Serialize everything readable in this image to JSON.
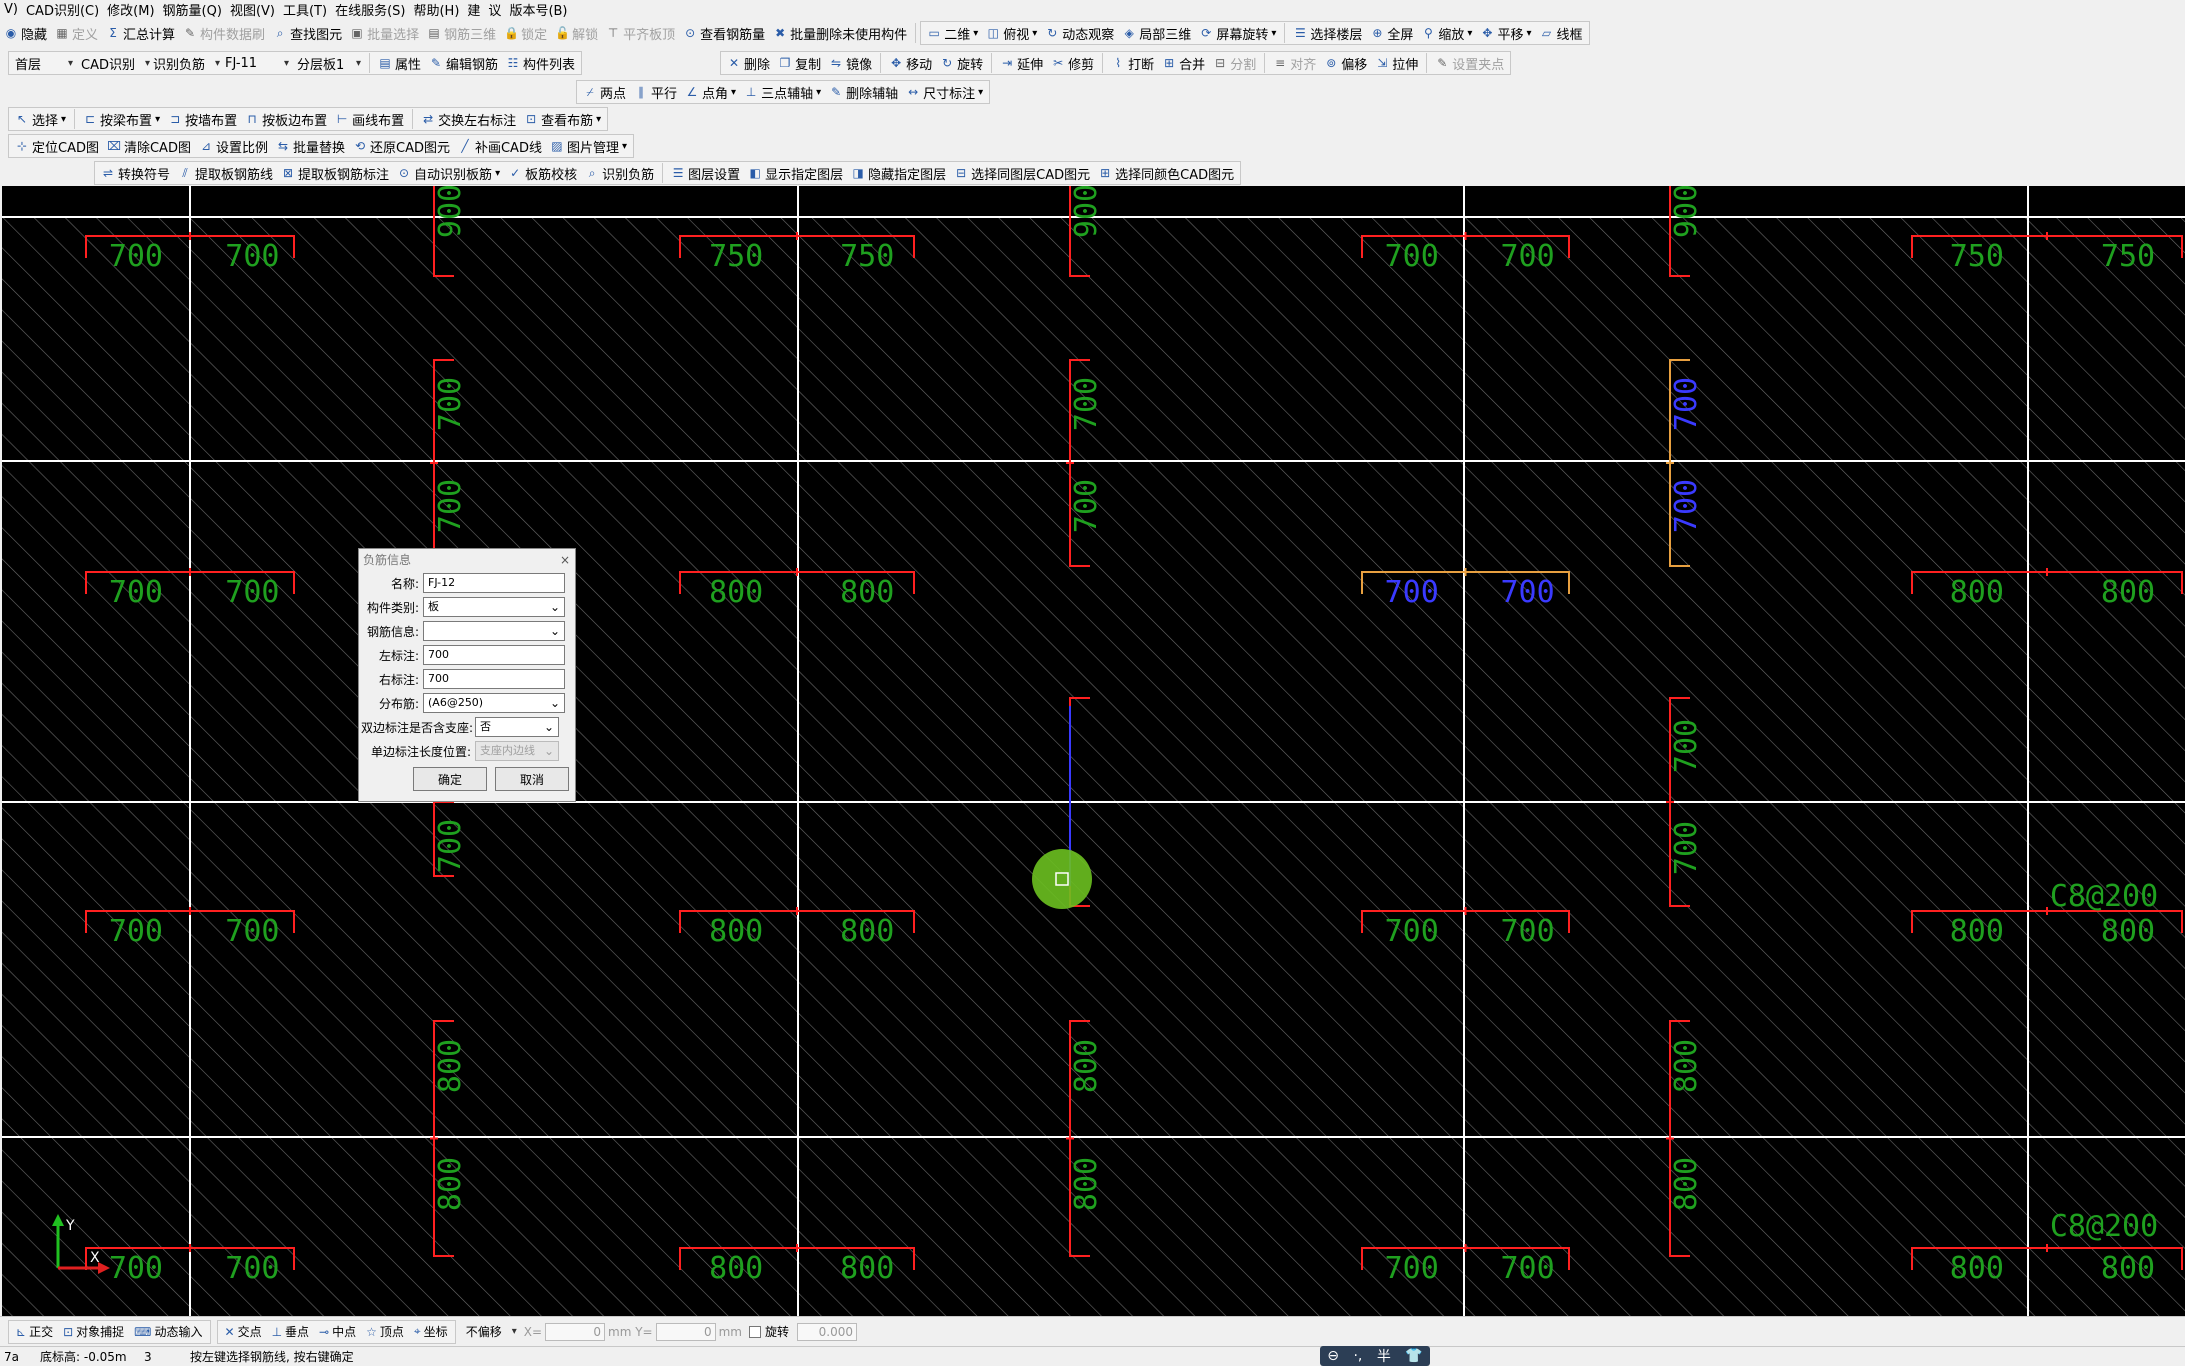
{
  "menu": [
    "V)",
    "CAD识别(C)",
    "修改(M)",
    "钢筋量(Q)",
    "视图(V)",
    "工具(T)",
    "在线服务(S)",
    "帮助(H)",
    "建",
    "议",
    "版本号(B)"
  ],
  "toolbar1": {
    "items": [
      {
        "label": "隐藏",
        "icon": "eye-icon",
        "disabled": false
      },
      {
        "label": "定义",
        "icon": "define-icon",
        "disabled": true
      },
      {
        "label": "汇总计算",
        "icon": "sigma-icon",
        "disabled": false
      },
      {
        "label": "构件数据刷",
        "icon": "brush-icon",
        "disabled": true
      },
      {
        "label": "查找图元",
        "icon": "binoculars-icon",
        "disabled": false
      },
      {
        "label": "批量选择",
        "icon": "batch-select-icon",
        "disabled": true
      },
      {
        "label": "钢筋三维",
        "icon": "rebar-3d-icon",
        "disabled": true
      },
      {
        "label": "锁定",
        "icon": "lock-icon",
        "disabled": true
      },
      {
        "label": "解锁",
        "icon": "unlock-icon",
        "disabled": true
      },
      {
        "label": "平齐板顶",
        "icon": "align-top-icon",
        "disabled": true
      },
      {
        "label": "查看钢筋量",
        "icon": "view-rebar-icon",
        "disabled": false
      },
      {
        "label": "批量删除未使用构件",
        "icon": "batch-delete-icon",
        "disabled": false
      }
    ],
    "view_items": [
      {
        "label": "二维",
        "icon": "2d-icon",
        "dropdown": true
      },
      {
        "label": "俯视",
        "icon": "top-view-icon",
        "dropdown": true
      },
      {
        "label": "动态观察",
        "icon": "orbit-icon",
        "dropdown": false
      },
      {
        "label": "局部三维",
        "icon": "local-3d-icon",
        "dropdown": false
      },
      {
        "label": "屏幕旋转",
        "icon": "rotate-screen-icon",
        "dropdown": true
      },
      {
        "label": "选择楼层",
        "icon": "floor-select-icon",
        "dropdown": false
      },
      {
        "label": "全屏",
        "icon": "zoom-all-icon",
        "dropdown": false
      },
      {
        "label": "缩放",
        "icon": "zoom-icon",
        "dropdown": true
      },
      {
        "label": "平移",
        "icon": "pan-icon",
        "dropdown": true
      },
      {
        "label": "线框",
        "icon": "wireframe-icon",
        "dropdown": false
      }
    ]
  },
  "toolbar2": {
    "selects": [
      "首层",
      "CAD识别",
      "识别负筋",
      "FJ-11",
      "分层板1"
    ],
    "items": [
      {
        "label": "属性",
        "icon": "properties-icon"
      },
      {
        "label": "编辑钢筋",
        "icon": "edit-rebar-icon"
      },
      {
        "label": "构件列表",
        "icon": "component-list-icon"
      }
    ],
    "edit_items": [
      {
        "label": "删除",
        "icon": "delete-icon",
        "disabled": false
      },
      {
        "label": "复制",
        "icon": "copy-icon",
        "disabled": false
      },
      {
        "label": "镜像",
        "icon": "mirror-icon",
        "disabled": false
      },
      {
        "label": "移动",
        "icon": "move-icon",
        "disabled": false
      },
      {
        "label": "旋转",
        "icon": "rotate-icon",
        "disabled": false
      },
      {
        "label": "延伸",
        "icon": "extend-icon",
        "disabled": false
      },
      {
        "label": "修剪",
        "icon": "trim-icon",
        "disabled": false
      },
      {
        "label": "打断",
        "icon": "break-icon",
        "disabled": false
      },
      {
        "label": "合并",
        "icon": "merge-icon",
        "disabled": false
      },
      {
        "label": "分割",
        "icon": "split-icon",
        "disabled": true
      },
      {
        "label": "对齐",
        "icon": "align-icon",
        "disabled": true
      },
      {
        "label": "偏移",
        "icon": "offset-icon",
        "disabled": false
      },
      {
        "label": "拉伸",
        "icon": "stretch-icon",
        "disabled": false
      },
      {
        "label": "设置夹点",
        "icon": "grip-icon",
        "disabled": true
      }
    ]
  },
  "toolbar3": {
    "items": [
      {
        "label": "两点",
        "icon": "two-point-axis-icon"
      },
      {
        "label": "平行",
        "icon": "parallel-axis-icon"
      },
      {
        "label": "点角",
        "icon": "point-angle-icon",
        "dropdown": true
      },
      {
        "label": "三点辅轴",
        "icon": "three-point-axis-icon",
        "dropdown": true
      },
      {
        "label": "删除辅轴",
        "icon": "delete-axis-icon"
      },
      {
        "label": "尺寸标注",
        "icon": "dimension-icon",
        "dropdown": true
      }
    ]
  },
  "toolbar4": {
    "items": [
      {
        "label": "选择",
        "icon": "cursor-icon",
        "dropdown": true
      },
      {
        "label": "按梁布置",
        "icon": "beam-layout-icon",
        "dropdown": true
      },
      {
        "label": "按墙布置",
        "icon": "wall-layout-icon"
      },
      {
        "label": "按板边布置",
        "icon": "slab-edge-layout-icon"
      },
      {
        "label": "画线布置",
        "icon": "line-layout-icon"
      },
      {
        "label": "交换左右标注",
        "icon": "swap-label-icon"
      },
      {
        "label": "查看布筋",
        "icon": "view-layout-icon",
        "dropdown": true
      }
    ]
  },
  "toolbar5": {
    "items": [
      {
        "label": "定位CAD图",
        "icon": "locate-cad-icon"
      },
      {
        "label": "清除CAD图",
        "icon": "clear-cad-icon"
      },
      {
        "label": "设置比例",
        "icon": "scale-icon"
      },
      {
        "label": "批量替换",
        "icon": "batch-replace-icon"
      },
      {
        "label": "还原CAD图元",
        "icon": "restore-cad-icon"
      },
      {
        "label": "补画CAD线",
        "icon": "draw-cad-line-icon"
      },
      {
        "label": "图片管理",
        "icon": "image-manage-icon",
        "dropdown": true
      }
    ]
  },
  "toolbar6": {
    "items": [
      {
        "label": "转换符号",
        "icon": "convert-symbol-icon"
      },
      {
        "label": "提取板钢筋线",
        "icon": "extract-line-icon"
      },
      {
        "label": "提取板钢筋标注",
        "icon": "extract-label-icon"
      },
      {
        "label": "自动识别板筋",
        "icon": "auto-identify-icon",
        "dropdown": true
      },
      {
        "label": "板筋校核",
        "icon": "check-icon"
      },
      {
        "label": "识别负筋",
        "icon": "identify-neg-icon"
      }
    ],
    "layer_items": [
      {
        "label": "图层设置",
        "icon": "layer-settings-icon"
      },
      {
        "label": "显示指定图层",
        "icon": "show-layer-icon"
      },
      {
        "label": "隐藏指定图层",
        "icon": "hide-layer-icon"
      },
      {
        "label": "选择同图层CAD图元",
        "icon": "same-layer-icon"
      },
      {
        "label": "选择同颜色CAD图元",
        "icon": "same-color-icon"
      }
    ]
  },
  "dialog": {
    "title": "负筋信息",
    "fields": [
      {
        "label": "名称:",
        "value": "FJ-12",
        "type": "text"
      },
      {
        "label": "构件类别:",
        "value": "板",
        "type": "select"
      },
      {
        "label": "钢筋信息:",
        "value": "",
        "type": "select"
      },
      {
        "label": "左标注:",
        "value": "700",
        "type": "text"
      },
      {
        "label": "右标注:",
        "value": "700",
        "type": "text"
      },
      {
        "label": "分布筋:",
        "value": "(A6@250)",
        "type": "select"
      }
    ],
    "double_label": "双边标注是否含支座:",
    "double_value": "否",
    "single_label": "单边标注长度位置:",
    "single_value": "支座内边线",
    "ok": "确定",
    "cancel": "取消"
  },
  "canvas": {
    "colors": {
      "background": "#000000",
      "grid": "#ffffff",
      "hatch": "#6a6a6a",
      "bracket": "#ff2020",
      "text": "#1fa01f",
      "highlight": "#e8a040",
      "selected_text": "#3a3aff",
      "cursor": "#6cc020"
    },
    "rows": [
      {
        "labels": [
          "700",
          "700",
          "750",
          "750",
          "700",
          "700",
          "750",
          "750"
        ]
      },
      {
        "labels": [
          "700",
          "700",
          "800",
          "800",
          "700",
          "700",
          "800",
          "800"
        ]
      },
      {
        "labels": [
          "700",
          "700",
          "800",
          "800",
          "700",
          "700",
          "800",
          "800"
        ]
      },
      {
        "labels": [
          "700",
          "700",
          "800",
          "800",
          "700",
          "700",
          "800",
          "800"
        ]
      }
    ],
    "vertical_labels": {
      "top": [
        "900",
        "900",
        "900"
      ],
      "mid1": [
        "700",
        "700",
        "700"
      ],
      "mid2": [
        "700",
        "700",
        "700"
      ],
      "low1": [
        "700",
        "700"
      ],
      "low2": [
        "800",
        "800",
        "800"
      ],
      "low3": [
        "800",
        "800",
        "800"
      ]
    },
    "rebar_labels": [
      "C8@200",
      "C8@200"
    ],
    "axis": {
      "x": "X",
      "y": "Y"
    }
  },
  "statusbar": {
    "toggles": [
      {
        "label": "正交",
        "icon": "ortho-icon"
      },
      {
        "label": "对象捕捉",
        "icon": "snap-icon"
      },
      {
        "label": "动态输入",
        "icon": "dynamic-input-icon"
      }
    ],
    "snaps": [
      {
        "label": "交点",
        "icon": "intersection-icon"
      },
      {
        "label": "垂点",
        "icon": "perpendicular-icon"
      },
      {
        "label": "中点",
        "icon": "midpoint-icon"
      },
      {
        "label": "顶点",
        "icon": "vertex-icon"
      },
      {
        "label": "坐标",
        "icon": "coordinate-icon"
      }
    ],
    "offset": "不偏移",
    "x_label": "X=",
    "x_value": "0",
    "y_label": "mm Y=",
    "y_value": "0",
    "unit": "mm",
    "rotate_label": "旋转",
    "rotate_value": "0.000"
  },
  "prompt": {
    "left": "7a",
    "elevation": "底标高: -0.05m",
    "count": "3",
    "message": "按左键选择钢筋线, 按右键确定"
  },
  "ime": {
    "items": [
      "⊖",
      "·,",
      "半",
      "👕"
    ]
  }
}
